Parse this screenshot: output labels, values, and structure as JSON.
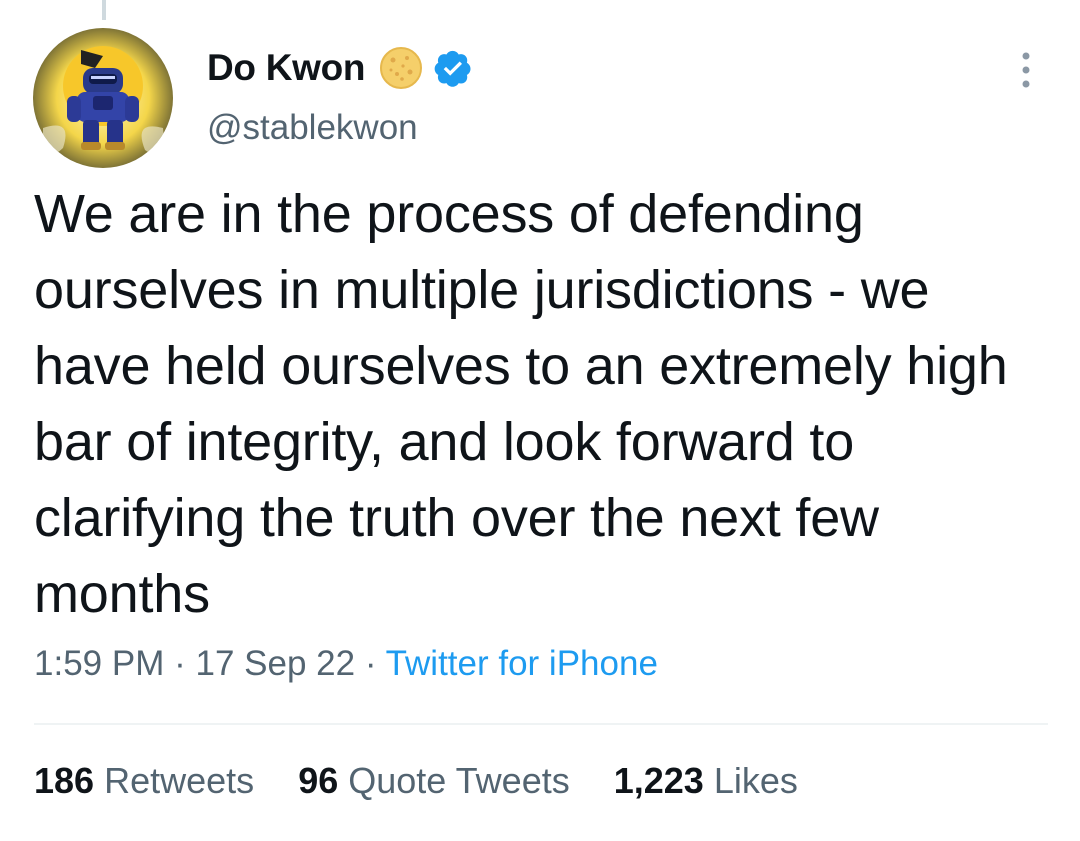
{
  "user": {
    "display_name": "Do Kwon",
    "handle": "@stablekwon",
    "avatar_icon": "robot-avatar",
    "badge_icon": "cookie-emoji-icon",
    "verified_icon": "verified-badge-icon"
  },
  "tweet": {
    "text": "We are in the process of defending ourselves in multiple jurisdictions - we have held ourselves to an extremely high bar of integrity, and look forward to clarifying the truth over the next few months",
    "time": "1:59 PM",
    "separator": "·",
    "date": "17 Sep 22",
    "source": "Twitter for iPhone"
  },
  "stats": {
    "retweets_count": "186",
    "retweets_label": "Retweets",
    "quotes_count": "96",
    "quotes_label": "Quote Tweets",
    "likes_count": "1,223",
    "likes_label": "Likes"
  },
  "colors": {
    "text_primary": "#0f1419",
    "text_secondary": "#536471",
    "link_blue": "#1d9bf0",
    "verified_blue": "#1d9bf0",
    "divider": "#eff3f4"
  }
}
